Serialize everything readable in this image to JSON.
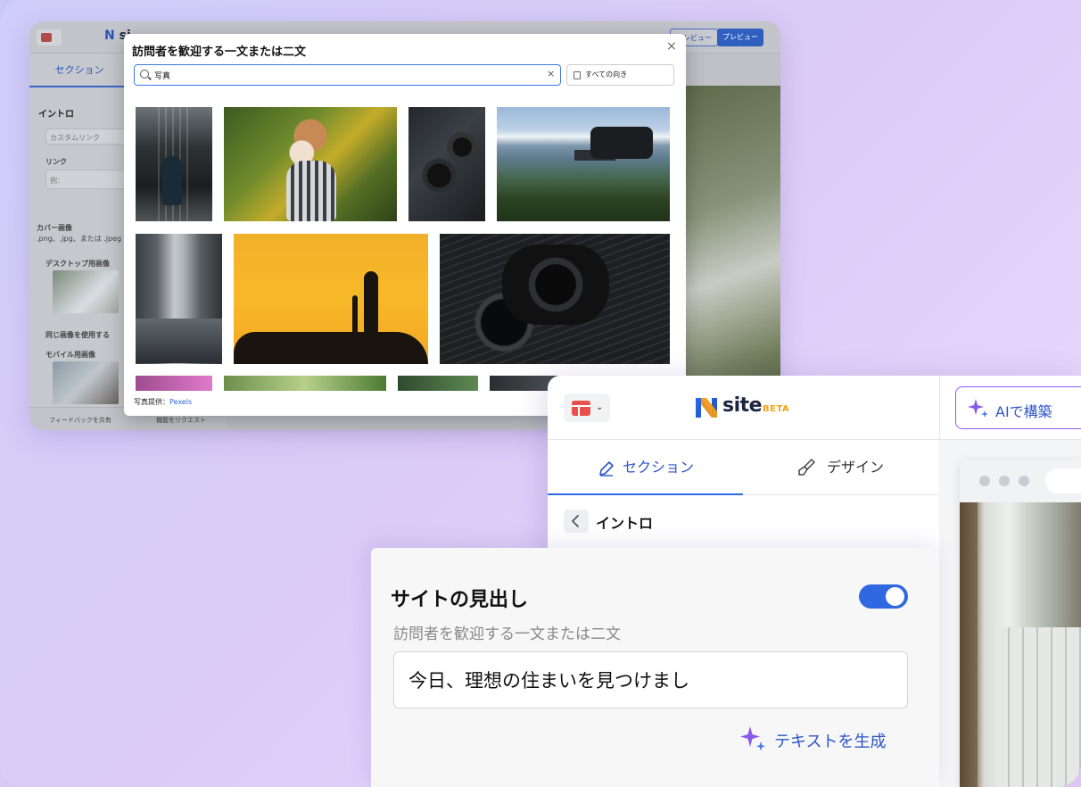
{
  "back_window": {
    "logo_text": "si",
    "sections_tab": "セクション",
    "intro": "イントロ",
    "custom_link_placeholder": "カスタムリンク",
    "link_label": "リンク",
    "link_placeholder": "例：",
    "cover_image_label": "カバー画像",
    "cover_image_hint": ".png、.jpg、または .jpeg を",
    "desktop_image_label": "デスクトップ用画像",
    "same_image_label": "同じ画像を使用する",
    "mobile_image_label": "モバイル用画像",
    "feedback_label": "フィードバックを共有",
    "feature_request_label": "機能をリクエスト",
    "preview_label_1": "プレビュー",
    "preview_label_2": "プレビュー"
  },
  "modal": {
    "title": "訪問者を歓迎する一文または二文",
    "close_glyph": "×",
    "search_value": "写真",
    "clear_glyph": "×",
    "orientation_label": "すべての向き",
    "credit_prefix": "写真提供：",
    "credit_link": "Pexels"
  },
  "front_window": {
    "logo_word": "site",
    "logo_badge": "BETA",
    "ai_button_label": "AIで構築",
    "tabs": [
      {
        "label": "セクション",
        "active": true
      },
      {
        "label": "デザイン",
        "active": false
      }
    ],
    "intro_label": "イントロ"
  },
  "headline_card": {
    "title": "サイトの見出し",
    "toggle_on": true,
    "subtitle": "訪問者を歓迎する一文または二文",
    "input_value": "今日、理想の住まいを見つけまし",
    "generate_label": "テキストを生成"
  },
  "colors": {
    "accent_blue": "#2f68e0",
    "link_blue": "#2c55c8",
    "ai_purple": "#8a5be8",
    "beta_orange": "#f3a219",
    "layout_red": "#e8514b"
  },
  "icons": {
    "search": "search-icon",
    "close": "close-icon",
    "orientation": "orientation-icon",
    "sparkle": "sparkle-icon",
    "pencil": "pencil-icon",
    "brush": "brush-icon",
    "back": "chevron-left-icon",
    "layout": "layout-icon",
    "dropdown": "chevron-down-icon"
  }
}
